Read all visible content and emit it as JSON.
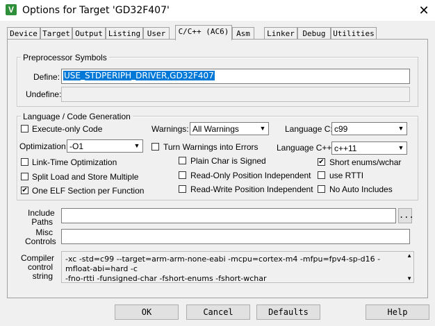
{
  "window": {
    "title": "Options for Target 'GD32F407'",
    "close": "✕",
    "app_icon": "V"
  },
  "tabs": [
    "Device",
    "Target",
    "Output",
    "Listing",
    "User",
    "C/C++ (AC6)",
    "Asm",
    "Linker",
    "Debug",
    "Utilities"
  ],
  "active_tab": "C/C++ (AC6)",
  "preprocessor": {
    "group_title": "Preprocessor Symbols",
    "define_label": "Define:",
    "define_value": "USE_STDPERIPH_DRIVER,GD32F407",
    "undefine_label": "Undefine:",
    "undefine_value": ""
  },
  "language": {
    "group_title": "Language / Code Generation",
    "execute_only": {
      "label": "Execute-only Code",
      "checked": false
    },
    "warnings_label": "Warnings:",
    "warnings_value": "All Warnings",
    "language_c_label": "Language C:",
    "language_c_value": "c99",
    "optimization_label": "Optimization:",
    "optimization_value": "-O1",
    "warnings_errors": {
      "label": "Turn Warnings into Errors",
      "checked": false
    },
    "language_cpp_label": "Language C++:",
    "language_cpp_value": "c++11",
    "link_time": {
      "label": "Link-Time Optimization",
      "checked": false
    },
    "plain_char": {
      "label": "Plain Char is Signed",
      "checked": false
    },
    "short_enums": {
      "label": "Short enums/wchar",
      "checked": true
    },
    "split_load": {
      "label": "Split Load and Store Multiple",
      "checked": false
    },
    "ro_pi": {
      "label": "Read-Only Position Independent",
      "checked": false
    },
    "use_rtti": {
      "label": "use RTTI",
      "checked": false
    },
    "one_elf": {
      "label": "One ELF Section per Function",
      "checked": true
    },
    "rw_pi": {
      "label": "Read-Write Position Independent",
      "checked": false
    },
    "no_auto_includes": {
      "label": "No Auto Includes",
      "checked": false
    }
  },
  "include": {
    "label_line1": "Include",
    "label_line2": "Paths",
    "value": "",
    "browse": "..."
  },
  "misc": {
    "label_line1": "Misc",
    "label_line2": "Controls",
    "value": ""
  },
  "compiler": {
    "label_line1": "Compiler",
    "label_line2": "control",
    "label_line3": "string",
    "value": "-xc -std=c99 --target=arm-arm-none-eabi -mcpu=cortex-m4 -mfpu=fpv4-sp-d16 -mfloat-abi=hard -c\n-fno-rtti -funsigned-char -fshort-enums -fshort-wchar"
  },
  "buttons": {
    "ok": "OK",
    "cancel": "Cancel",
    "defaults": "Defaults",
    "help": "Help"
  },
  "icons": {
    "scroll_up": "▲",
    "scroll_down": "▼",
    "dropdown": "▼",
    "check": "✔"
  }
}
